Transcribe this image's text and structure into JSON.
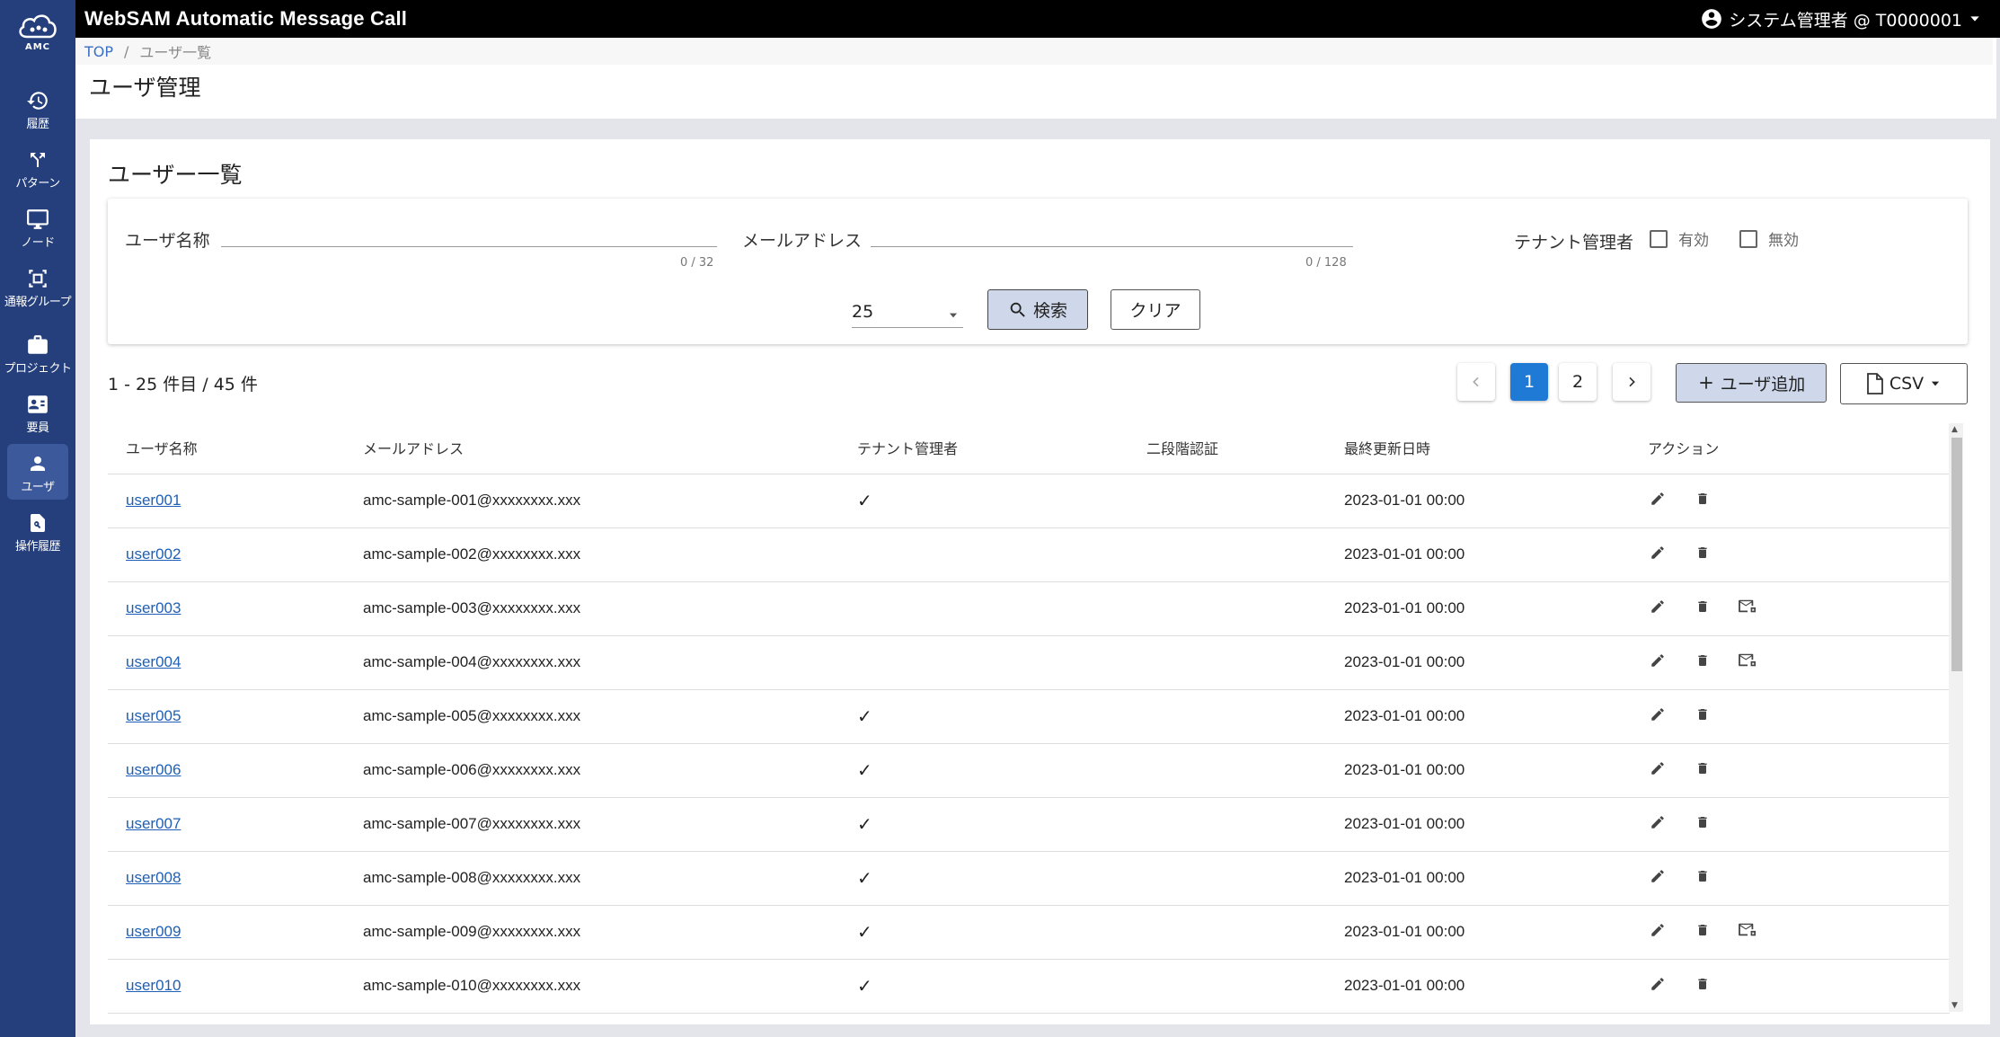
{
  "app": {
    "title": "WebSAM Automatic Message Call",
    "logo_text": "AMC",
    "user": "システム管理者 @ T0000001"
  },
  "sidebar": {
    "items": [
      {
        "label": "履歴",
        "icon": "history-icon"
      },
      {
        "label": "パターン",
        "icon": "pattern-icon"
      },
      {
        "label": "ノード",
        "icon": "monitor-icon"
      },
      {
        "label": "通報グループ",
        "icon": "group-icon"
      },
      {
        "label": "プロジェクト",
        "icon": "briefcase-icon"
      },
      {
        "label": "要員",
        "icon": "contact-card-icon"
      },
      {
        "label": "ユーザ",
        "icon": "person-icon",
        "active": true
      },
      {
        "label": "操作履歴",
        "icon": "search-doc-icon"
      }
    ]
  },
  "breadcrumb": {
    "top": "TOP",
    "sep": "/",
    "current": "ユーザ一覧"
  },
  "page_title": "ユーザ管理",
  "card_title": "ユーザー一覧",
  "search": {
    "username_label": "ユーザ名称",
    "username_value": "",
    "username_counter": "0 / 32",
    "email_label": "メールアドレス",
    "email_value": "",
    "email_counter": "0 / 128",
    "tenant_admin_label": "テナント管理者",
    "enabled_label": "有効",
    "disabled_label": "無効",
    "page_size": "25",
    "search_button": "検索",
    "clear_button": "クリア"
  },
  "results": {
    "count_text": "1 - 25 件目 / 45 件",
    "pages": [
      "1",
      "2"
    ],
    "current_page": "1",
    "add_button": "ユーザ追加",
    "csv_button": "CSV"
  },
  "table": {
    "headers": [
      "ユーザ名称",
      "メールアドレス",
      "テナント管理者",
      "二段階認証",
      "最終更新日時",
      "アクション"
    ],
    "rows": [
      {
        "name": "user001",
        "email": "amc-sample-001@xxxxxxxx.xxx",
        "admin": "✓",
        "twofa": "",
        "updated": "2023-01-01 00:00",
        "mail_action": false
      },
      {
        "name": "user002",
        "email": "amc-sample-002@xxxxxxxx.xxx",
        "admin": "",
        "twofa": "",
        "updated": "2023-01-01 00:00",
        "mail_action": false
      },
      {
        "name": "user003",
        "email": "amc-sample-003@xxxxxxxx.xxx",
        "admin": "",
        "twofa": "",
        "updated": "2023-01-01 00:00",
        "mail_action": true
      },
      {
        "name": "user004",
        "email": "amc-sample-004@xxxxxxxx.xxx",
        "admin": "",
        "twofa": "",
        "updated": "2023-01-01 00:00",
        "mail_action": true
      },
      {
        "name": "user005",
        "email": "amc-sample-005@xxxxxxxx.xxx",
        "admin": "✓",
        "twofa": "",
        "updated": "2023-01-01 00:00",
        "mail_action": false
      },
      {
        "name": "user006",
        "email": "amc-sample-006@xxxxxxxx.xxx",
        "admin": "✓",
        "twofa": "",
        "updated": "2023-01-01 00:00",
        "mail_action": false
      },
      {
        "name": "user007",
        "email": "amc-sample-007@xxxxxxxx.xxx",
        "admin": "✓",
        "twofa": "",
        "updated": "2023-01-01 00:00",
        "mail_action": false
      },
      {
        "name": "user008",
        "email": "amc-sample-008@xxxxxxxx.xxx",
        "admin": "✓",
        "twofa": "",
        "updated": "2023-01-01 00:00",
        "mail_action": false
      },
      {
        "name": "user009",
        "email": "amc-sample-009@xxxxxxxx.xxx",
        "admin": "✓",
        "twofa": "",
        "updated": "2023-01-01 00:00",
        "mail_action": true
      },
      {
        "name": "user010",
        "email": "amc-sample-010@xxxxxxxx.xxx",
        "admin": "✓",
        "twofa": "",
        "updated": "2023-01-01 00:00",
        "mail_action": false
      }
    ]
  },
  "colors": {
    "sidebar": "#253f7c",
    "header": "#000000",
    "accent": "#1f7ad6",
    "link": "#1f5fb5"
  }
}
